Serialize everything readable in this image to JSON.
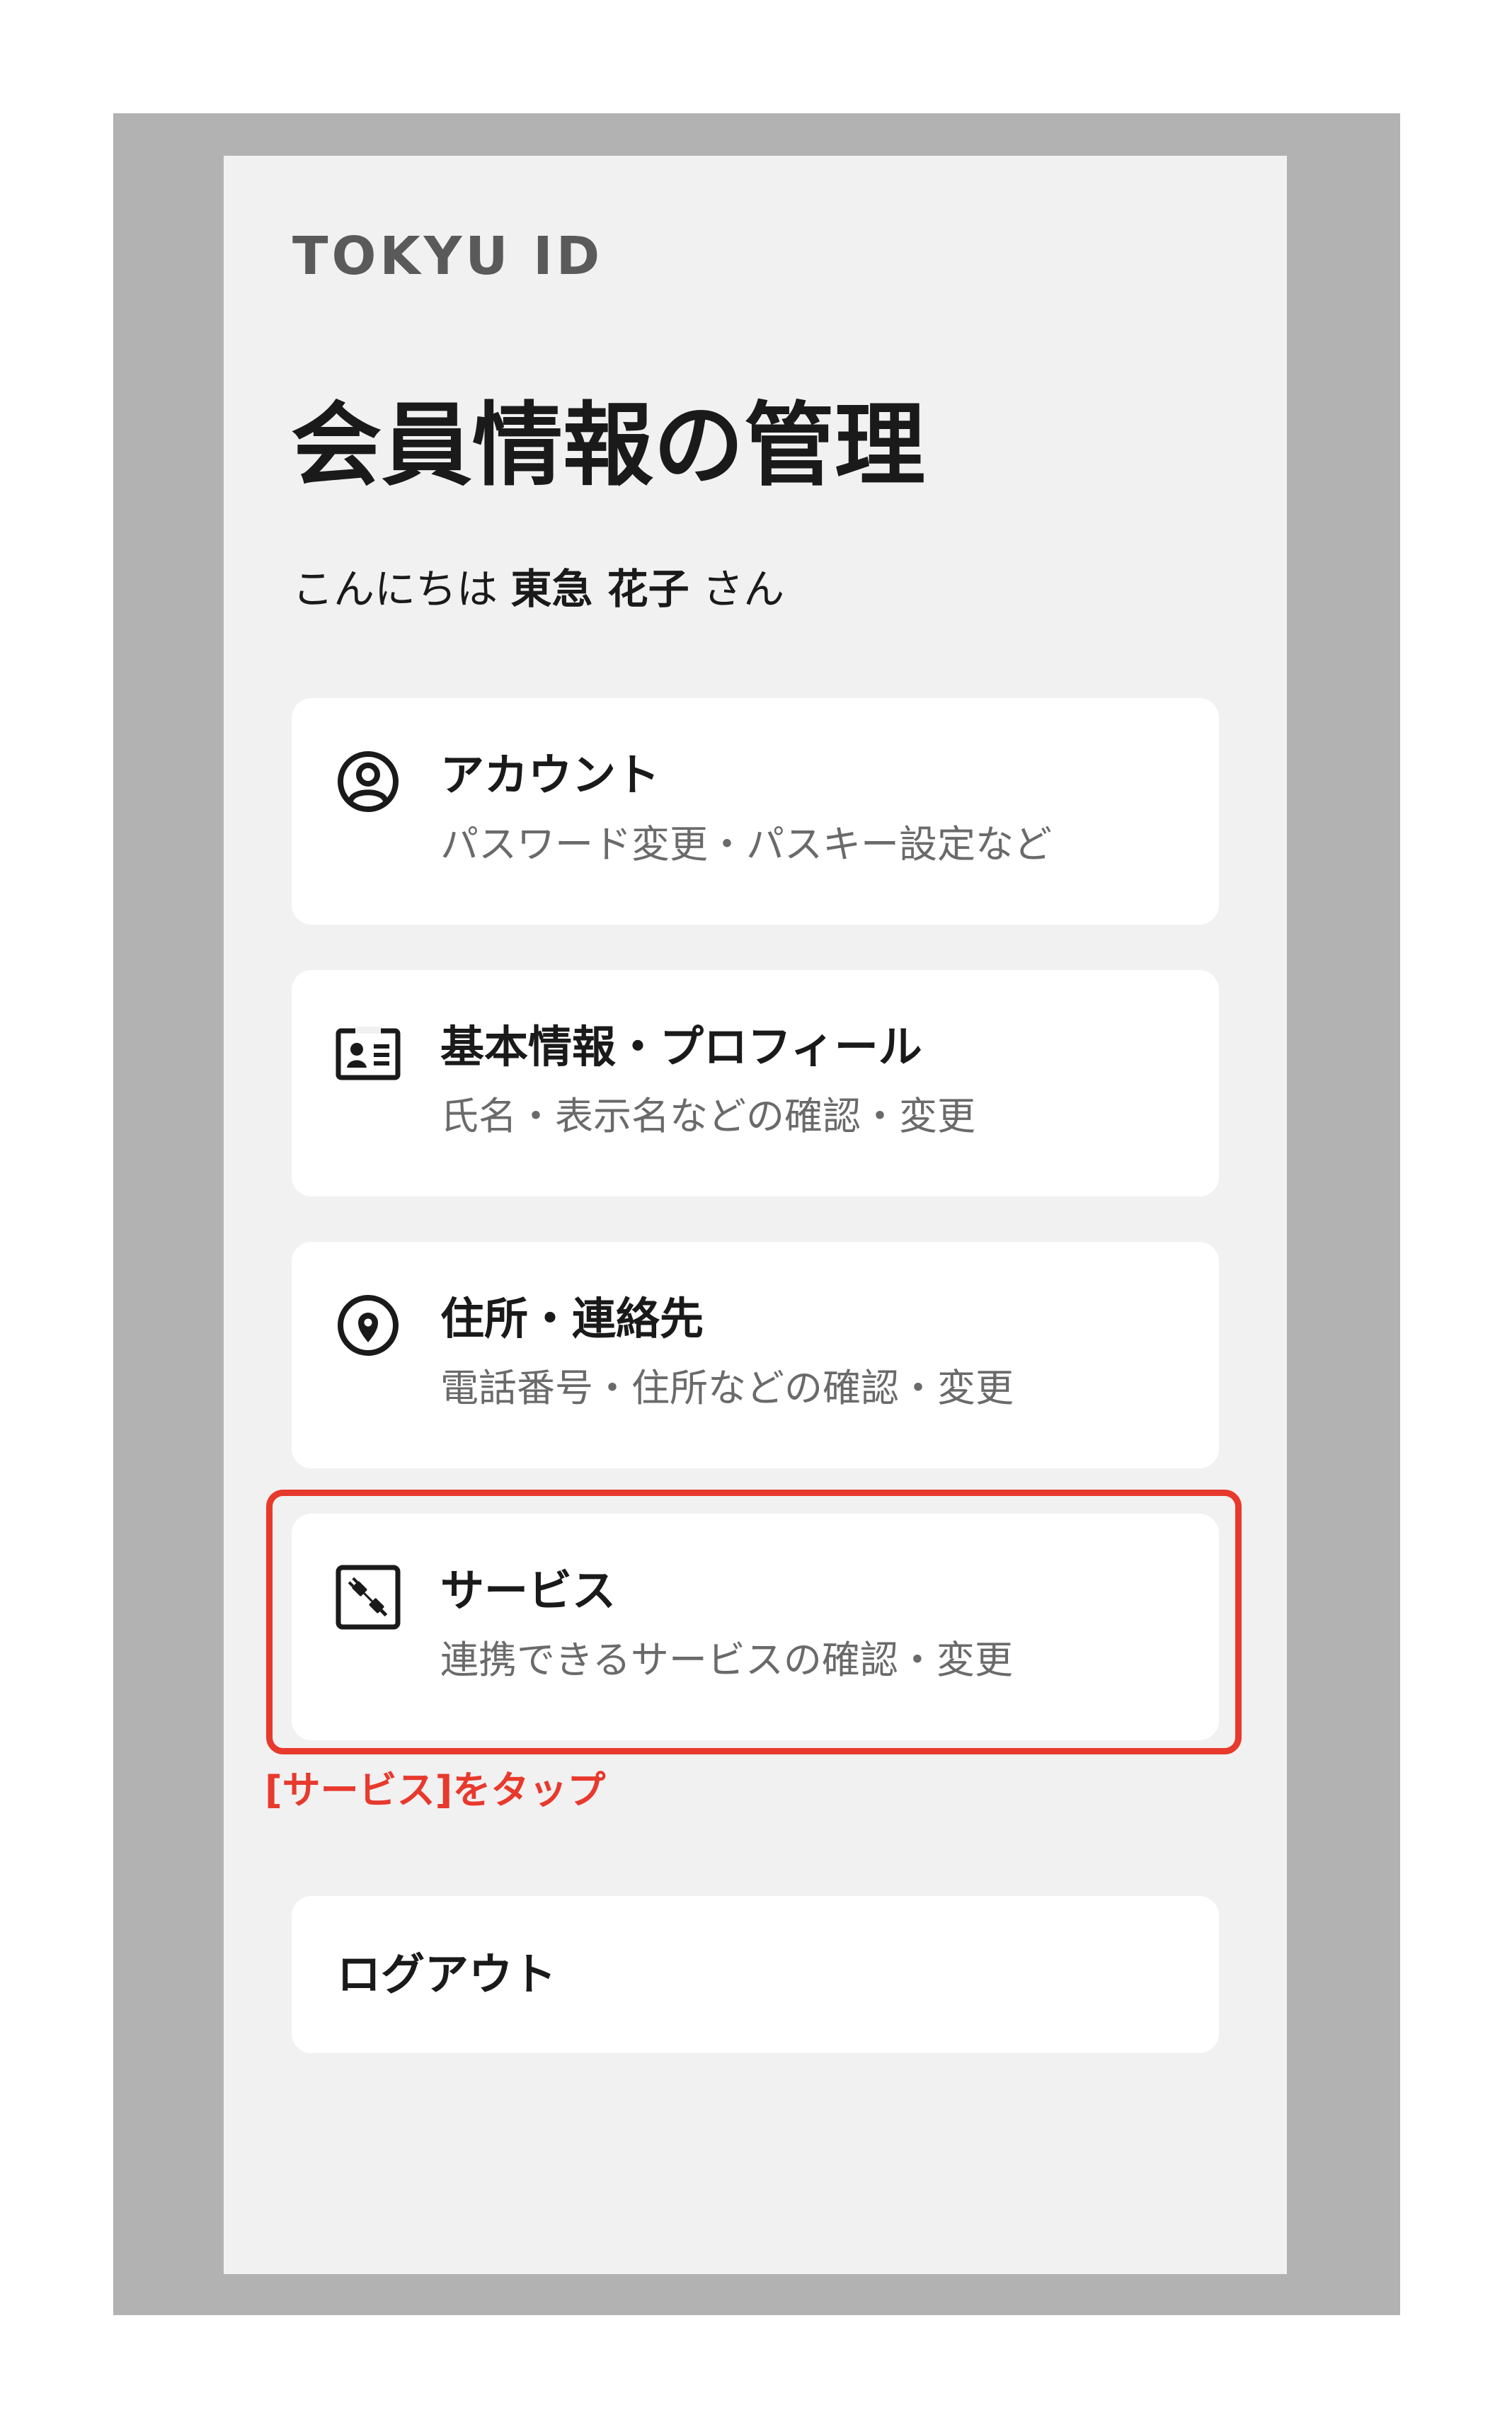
{
  "app": {
    "logo": "TOKYU ID"
  },
  "header": {
    "title": "会員情報の管理"
  },
  "greeting": {
    "prefix": "こんにちは ",
    "name": "東急 花子",
    "suffix": " さん"
  },
  "menu": [
    {
      "icon": "account-circle-icon",
      "title": "アカウント",
      "description": "パスワード変更・パスキー設定など"
    },
    {
      "icon": "id-card-icon",
      "title": "基本情報・プロフィール",
      "description": "氏名・表示名などの確認・変更"
    },
    {
      "icon": "location-pin-icon",
      "title": "住所・連絡先",
      "description": "電話番号・住所などの確認・変更"
    },
    {
      "icon": "plug-connect-icon",
      "title": "サービス",
      "description": "連携できるサービスの確認・変更"
    }
  ],
  "annotation": {
    "text": "[サービス]をタップ",
    "color": "#e8392d"
  },
  "logout": {
    "label": "ログアウト"
  }
}
